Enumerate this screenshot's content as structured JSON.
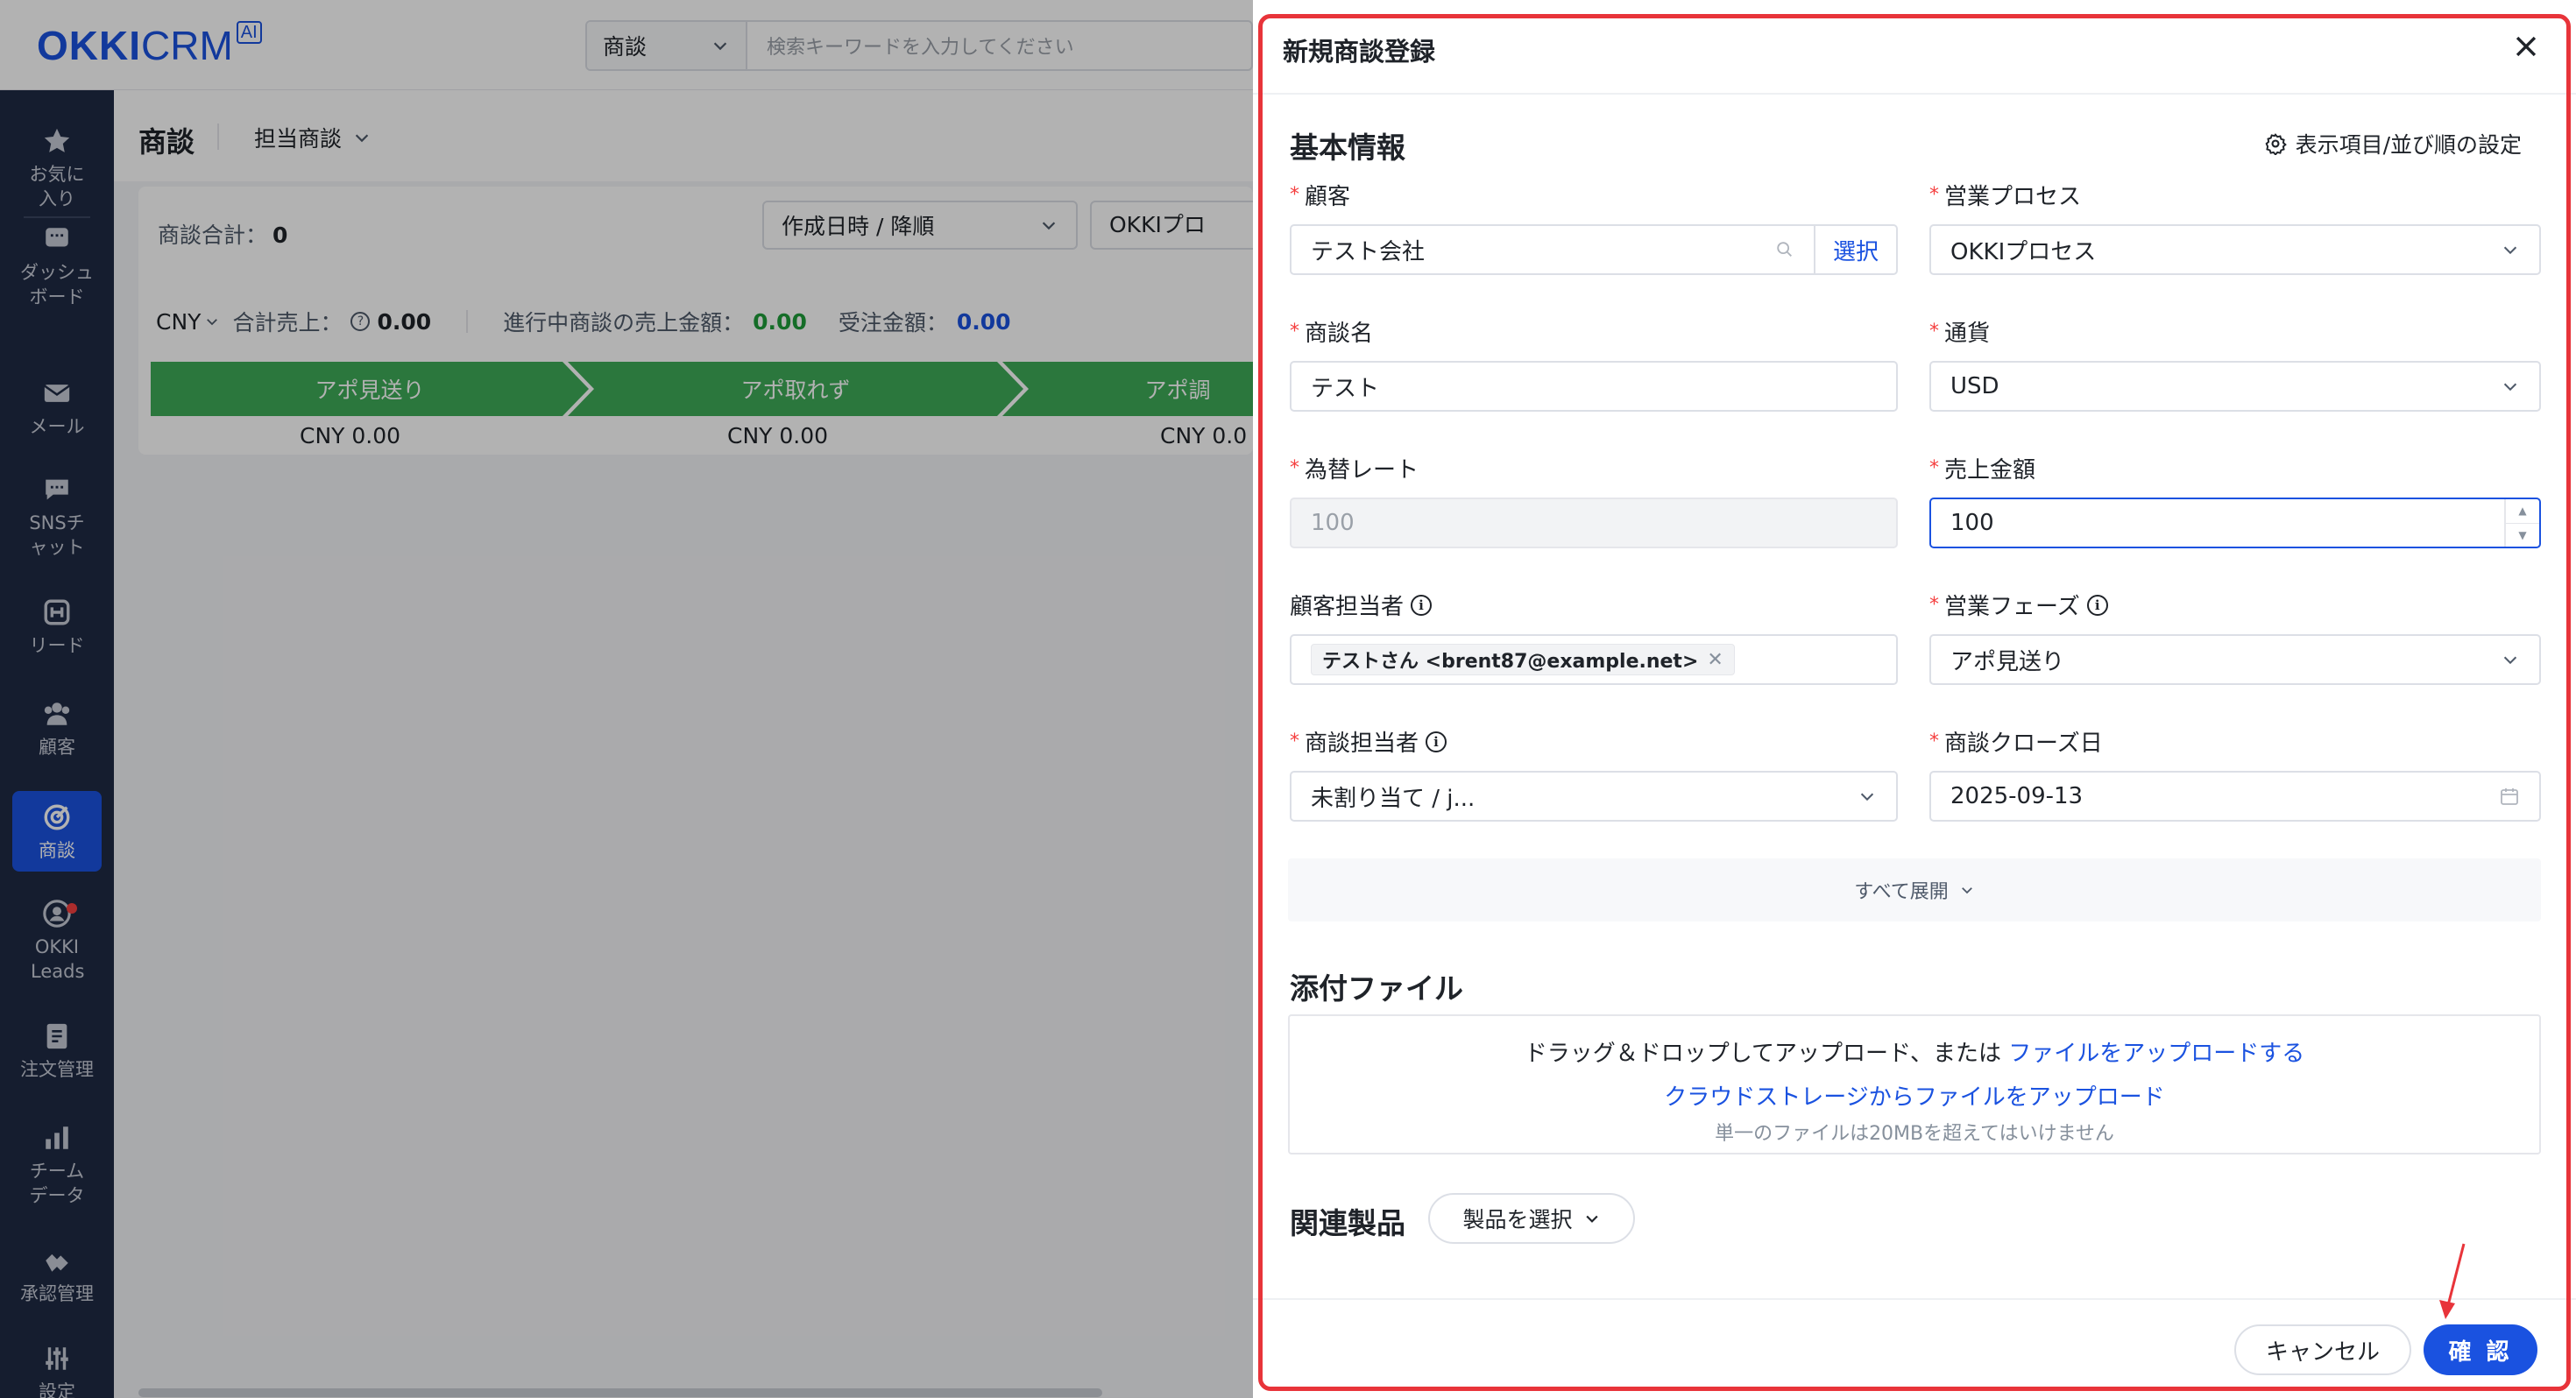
{
  "header": {
    "logo_main": "OKKI",
    "logo_sub": "CRM",
    "logo_badge": "AI",
    "search_scope": "商談",
    "search_placeholder": "検索キーワードを入力してください"
  },
  "sidebar": {
    "items": [
      {
        "label": "お気に入り",
        "icon": "star-icon"
      },
      {
        "label": "ダッシュボード",
        "icon": "dashboard-icon"
      },
      {
        "label": "メール",
        "icon": "mail-icon"
      },
      {
        "label": "SNSチャット",
        "icon": "chat-icon"
      },
      {
        "label": "リード",
        "icon": "lead-icon"
      },
      {
        "label": "顧客",
        "icon": "customers-icon"
      },
      {
        "label": "商談",
        "icon": "target-icon",
        "active": true
      },
      {
        "label": "OKKI Leads",
        "icon": "okki-leads-icon",
        "badge": true
      },
      {
        "label": "注文管理",
        "icon": "order-icon"
      },
      {
        "label": "チームデータ",
        "icon": "bar-chart-icon"
      },
      {
        "label": "承認管理",
        "icon": "approval-icon"
      },
      {
        "label": "設定",
        "icon": "settings-sliders-icon"
      }
    ]
  },
  "main": {
    "title": "商談",
    "filter": "担当商談",
    "total_label": "商談合計：",
    "total_value": "0",
    "sort": "作成日時 / 降順",
    "process_filter": "OKKIプロ",
    "currency": "CNY",
    "total_sales_label": "合計売上：",
    "total_sales_value": "0.00",
    "in_progress_label": "進行中商談の売上金額：",
    "in_progress_value": "0.00",
    "won_label": "受注金額：",
    "won_value": "0.00",
    "stages": [
      {
        "name": "アポ見送り",
        "amount": "CNY 0.00"
      },
      {
        "name": "アポ取れず",
        "amount": "CNY 0.00"
      },
      {
        "name": "アポ調",
        "amount": "CNY 0.0"
      }
    ]
  },
  "drawer": {
    "title": "新規商談登録",
    "basic_section": "基本情報",
    "settings_link": "表示項目/並び順の設定",
    "fields": {
      "customer": {
        "label": "顧客",
        "value": "テスト会社",
        "button": "選択"
      },
      "process": {
        "label": "営業プロセス",
        "value": "OKKIプロセス"
      },
      "deal_name": {
        "label": "商談名",
        "value": "テスト"
      },
      "currency": {
        "label": "通貨",
        "value": "USD"
      },
      "exchange_rate": {
        "label": "為替レート",
        "value": "100"
      },
      "sales_amount": {
        "label": "売上金額",
        "value": "100"
      },
      "contact": {
        "label": "顧客担当者",
        "tag": "テストさん <brent87@example.net>"
      },
      "phase": {
        "label": "営業フェーズ",
        "value": "アポ見送り"
      },
      "owner": {
        "label": "商談担当者",
        "value": "未割り当て / j..."
      },
      "close_date": {
        "label": "商談クローズ日",
        "value": "2025-09-13"
      }
    },
    "expand_all": "すべて展開",
    "attachment_section": "添付ファイル",
    "upload_text": "ドラッグ＆ドロップしてアップロード、または",
    "upload_link": "ファイルをアップロードする",
    "cloud_link": "クラウドストレージからファイルをアップロード",
    "size_note": "単一のファイルは20MBを超えてはいけません",
    "products_section": "関連製品",
    "products_button": "製品を選択",
    "cancel": "キャンセル",
    "confirm": "確 認"
  },
  "colors": {
    "brand": "#1a52e0",
    "stage_green": "#3eab58",
    "highlight_red": "#e8343a",
    "sidebar_bg": "#1f2a44"
  }
}
